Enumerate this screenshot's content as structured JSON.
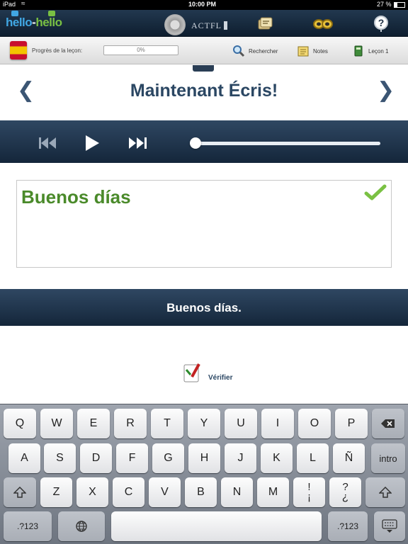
{
  "status_bar": {
    "device": "iPad",
    "time": "10:00 PM",
    "battery": "27 %"
  },
  "top_bar": {
    "logo": {
      "part1": "hello",
      "part2": "-",
      "part3": "hello"
    },
    "seal_text": "ACTFL",
    "icons": [
      "review-icon",
      "glasses-icon",
      "help-icon"
    ]
  },
  "lesson_bar": {
    "progress_label": "Progrès de la leçon:",
    "progress_value": "0%",
    "progress_fraction": 0,
    "search_label": "Rechercher",
    "notes_label": "Notes",
    "lesson_label": "Leçon 1"
  },
  "exercise": {
    "title": "Maintenant Écris!",
    "prev_arrow": "❮",
    "next_arrow": "❯",
    "answer_text": "Buenos días",
    "correct_answer": "Buenos días.",
    "verify_label": "Vérifier",
    "audio_position": 0
  },
  "keyboard": {
    "row1": [
      "Q",
      "W",
      "E",
      "R",
      "T",
      "Y",
      "U",
      "I",
      "O",
      "P"
    ],
    "row2": [
      "A",
      "S",
      "D",
      "F",
      "G",
      "H",
      "J",
      "K",
      "L",
      "Ñ"
    ],
    "return_label": "intro",
    "row3": [
      "Z",
      "X",
      "C",
      "V",
      "B",
      "N",
      "M"
    ],
    "punct1": {
      "top": "!",
      "bottom": "¡"
    },
    "punct2": {
      "top": "?",
      "bottom": "¿"
    },
    "numbers_label": ".?123"
  },
  "colors": {
    "accent": "#2b4763",
    "correct": "#4a8a2a",
    "check": "#7ac143"
  }
}
